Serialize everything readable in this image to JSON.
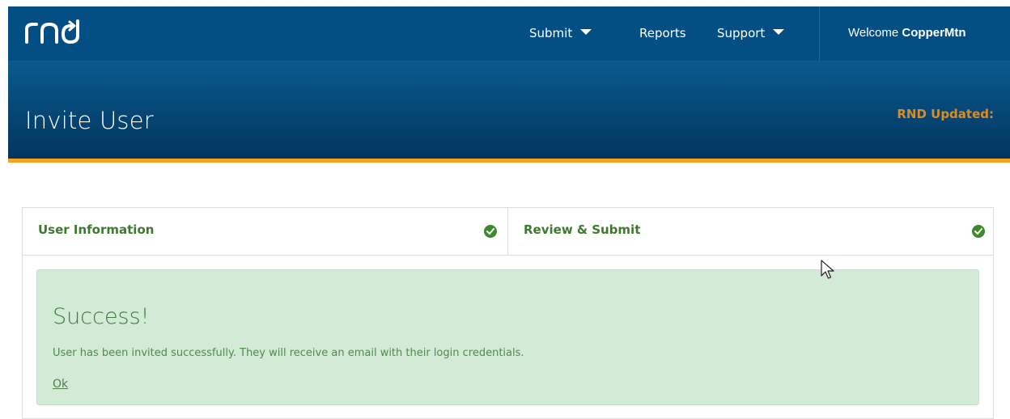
{
  "brand": {
    "logo_text": "rnd"
  },
  "nav": {
    "items": [
      {
        "label": "Submit",
        "has_dropdown": true
      },
      {
        "label": "Reports",
        "has_dropdown": false
      },
      {
        "label": "Support",
        "has_dropdown": true
      }
    ],
    "welcome_prefix": "Welcome",
    "username": "CopperMtn"
  },
  "header": {
    "title": "Invite User",
    "updated_label": "RND Updated:"
  },
  "wizard": {
    "steps": [
      {
        "label": "User Information",
        "status": "complete"
      },
      {
        "label": "Review & Submit",
        "status": "complete"
      }
    ]
  },
  "alert": {
    "title": "Success!",
    "message": "User has been invited successfully. They will receive an email with their login credentials.",
    "link": "Ok"
  },
  "colors": {
    "nav_bg": "#034f83",
    "header_bg": "#02355e",
    "accent_bar": "#f3a21f",
    "success_bg": "#d3ead6",
    "success_text": "#3c7a3a",
    "check_green": "#3d8a2b"
  }
}
